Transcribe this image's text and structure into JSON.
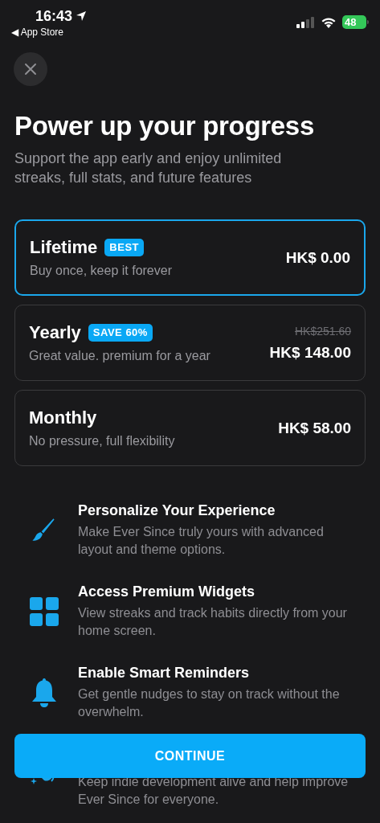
{
  "status_bar": {
    "time": "16:43",
    "back_label": "◀ App Store",
    "battery": "48"
  },
  "title": "Power up your progress",
  "subtitle": "Support the app early and enjoy unlimited streaks, full stats, and future features",
  "plans": [
    {
      "name": "Lifetime",
      "badge": "BEST",
      "description": "Buy once, keep it forever",
      "price": "HK$ 0.00",
      "selected": true
    },
    {
      "name": "Yearly",
      "badge": "SAVE 60%",
      "description": "Great value. premium for a year",
      "old_price": "HK$251.60",
      "price": "HK$ 148.00",
      "selected": false
    },
    {
      "name": "Monthly",
      "description": "No pressure, full flexibility",
      "price": "HK$ 58.00",
      "selected": false
    }
  ],
  "features": [
    {
      "kind": "brush",
      "title": "Personalize Your Experience",
      "description": "Make Ever Since truly yours with advanced layout and theme options."
    },
    {
      "kind": "widgets",
      "title": "Access Premium Widgets",
      "description": "View streaks and track habits directly from your home screen."
    },
    {
      "kind": "bell",
      "title": "Enable Smart Reminders",
      "description": "Get gentle nudges to stay on track without the overwhelm."
    },
    {
      "kind": "support",
      "description": "Keep indie development alive and help improve Ever Since for everyone."
    }
  ],
  "continue_button": "CONTINUE"
}
